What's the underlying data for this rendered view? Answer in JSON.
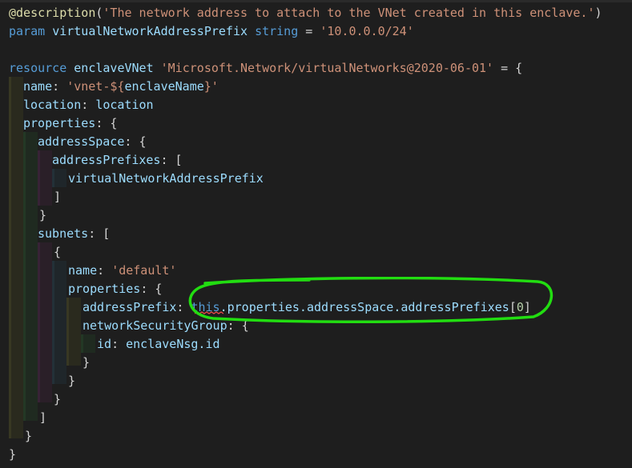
{
  "editor": {
    "language": "bicep",
    "lines": {
      "l1": {
        "decorator": "@description",
        "open": "(",
        "text": "'The network address to attach to the VNet created in this enclave.'",
        "close": ")"
      },
      "l2": {
        "kw": "param",
        "name": "virtualNetworkAddressPrefix",
        "type": "string",
        "eq": "=",
        "value": "'10.0.0.0/24'"
      },
      "l4": {
        "kw": "resource",
        "name": "enclaveVNet",
        "type": "'Microsoft.Network/virtualNetworks@2020-06-01'",
        "eq": "= {"
      },
      "l5": {
        "prop": "name",
        "colon": ":",
        "str1": "'vnet-${",
        "interp": "enclaveName",
        "str2": "}'"
      },
      "l6": {
        "prop": "location",
        "colon": ":",
        "value": "location"
      },
      "l7": {
        "prop": "properties",
        "colon": ":",
        "brace": "{"
      },
      "l8": {
        "prop": "addressSpace",
        "colon": ":",
        "brace": "{"
      },
      "l9": {
        "prop": "addressPrefixes",
        "colon": ":",
        "bracket": "["
      },
      "l10": {
        "value": "virtualNetworkAddressPrefix"
      },
      "l11": {
        "bracket": "]"
      },
      "l12": {
        "brace": "}"
      },
      "l13": {
        "prop": "subnets",
        "colon": ":",
        "bracket": "["
      },
      "l14": {
        "brace": "{"
      },
      "l15": {
        "prop": "name",
        "colon": ":",
        "value": "'default'"
      },
      "l16": {
        "prop": "properties",
        "colon": ":",
        "brace": "{"
      },
      "l17": {
        "prop": "addressPrefix",
        "colon": ":",
        "this": "this",
        "chain": ".properties.addressSpace.addressPrefixes",
        "lb": "[",
        "index": "0",
        "rb": "]"
      },
      "l18": {
        "prop": "networkSecurityGroup",
        "colon": ":",
        "brace": "{"
      },
      "l19": {
        "prop": "id",
        "colon": ":",
        "value": "enclaveNsg.id"
      },
      "l20": {
        "brace": "}"
      },
      "l21": {
        "brace": "}"
      },
      "l22": {
        "brace": "}"
      },
      "l23": {
        "bracket": "]"
      },
      "l24": {
        "brace": "}"
      },
      "l25": {
        "brace": "}"
      }
    }
  },
  "colors": {
    "background": "#1e1e1e",
    "keyword": "#569cd6",
    "string": "#ce9178",
    "identifier": "#9cdcfe",
    "decorator": "#dcdcaa",
    "number": "#b5cea8",
    "type": "#4ec9b0",
    "annotation": "#22dd11",
    "error_squiggle": "#f14c4c"
  }
}
